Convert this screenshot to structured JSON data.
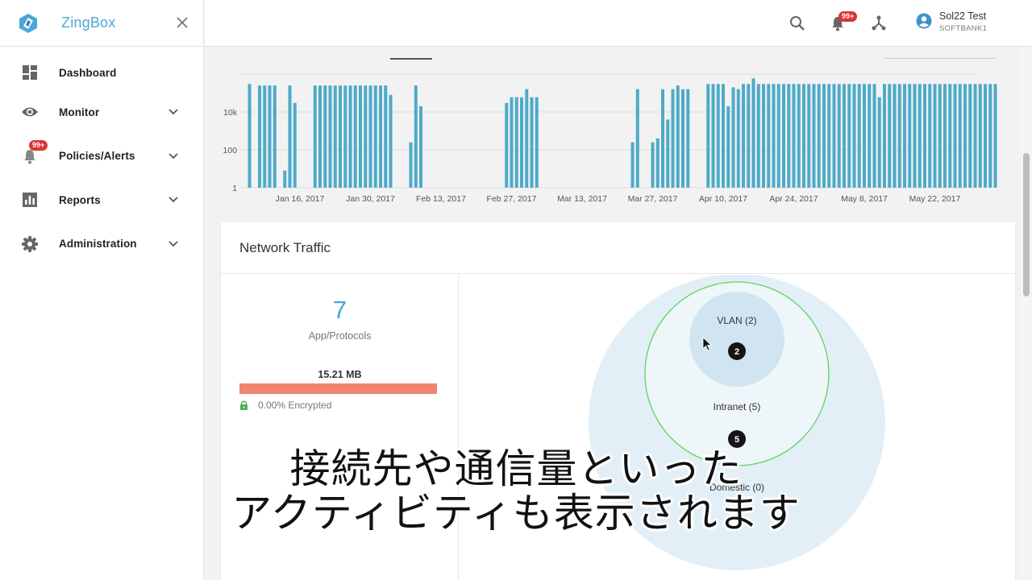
{
  "app": {
    "name": "ZingBox"
  },
  "sidebar": {
    "items": [
      {
        "label": "Dashboard",
        "icon": "dashboard-icon"
      },
      {
        "label": "Monitor",
        "icon": "eye-icon"
      },
      {
        "label": "Policies/Alerts",
        "icon": "bell-icon",
        "badge": "99+"
      },
      {
        "label": "Reports",
        "icon": "bar-chart-icon"
      },
      {
        "label": "Administration",
        "icon": "gear-icon"
      }
    ]
  },
  "topbar": {
    "notifications_badge": "99+",
    "user_name": "Sol22 Test",
    "user_org": "SOFTBANK1"
  },
  "chart_data": {
    "type": "bar",
    "y_scale": "log",
    "y_ticks": [
      "10k",
      "100",
      "1"
    ],
    "x_ticks": [
      "Jan 16, 2017",
      "Jan 30, 2017",
      "Feb 13, 2017",
      "Feb 27, 2017",
      "Mar 13, 2017",
      "Mar 27, 2017",
      "Apr 10, 2017",
      "Apr 24, 2017",
      "May 8, 2017",
      "May 22, 2017"
    ],
    "bar_color": "#4eaac8",
    "series": [
      {
        "x": [
          "2017-01-06",
          "2017-01-08",
          "2017-01-09",
          "2017-01-10",
          "2017-01-11",
          "2017-01-13",
          "2017-01-14",
          "2017-01-15",
          "2017-01-19",
          "2017-01-20",
          "2017-01-21",
          "2017-01-22",
          "2017-01-23",
          "2017-01-24",
          "2017-01-25",
          "2017-01-26",
          "2017-01-27",
          "2017-01-28",
          "2017-01-29",
          "2017-01-30",
          "2017-01-31",
          "2017-02-01",
          "2017-02-02",
          "2017-02-03",
          "2017-02-07",
          "2017-02-08",
          "2017-02-09",
          "2017-02-26",
          "2017-02-27",
          "2017-02-28",
          "2017-03-01",
          "2017-03-02",
          "2017-03-03",
          "2017-03-04",
          "2017-03-23",
          "2017-03-24",
          "2017-03-27",
          "2017-03-28",
          "2017-03-29",
          "2017-03-30",
          "2017-03-31",
          "2017-04-01",
          "2017-04-02",
          "2017-04-03",
          "2017-04-07",
          "2017-04-08",
          "2017-04-09",
          "2017-04-10",
          "2017-04-11",
          "2017-04-12",
          "2017-04-13",
          "2017-04-14",
          "2017-04-15",
          "2017-04-16",
          "2017-04-17",
          "2017-04-18",
          "2017-04-19",
          "2017-04-20",
          "2017-04-21",
          "2017-04-22",
          "2017-04-23",
          "2017-04-24",
          "2017-04-25",
          "2017-04-26",
          "2017-04-27",
          "2017-04-28",
          "2017-04-29",
          "2017-04-30",
          "2017-05-01",
          "2017-05-02",
          "2017-05-03",
          "2017-05-04",
          "2017-05-05",
          "2017-05-06",
          "2017-05-07",
          "2017-05-08",
          "2017-05-09",
          "2017-05-10",
          "2017-05-11",
          "2017-05-12",
          "2017-05-13",
          "2017-05-14",
          "2017-05-15",
          "2017-05-16",
          "2017-05-17",
          "2017-05-18",
          "2017-05-19",
          "2017-05-20",
          "2017-05-21",
          "2017-05-22",
          "2017-05-23",
          "2017-05-24",
          "2017-05-25",
          "2017-05-26",
          "2017-05-27",
          "2017-05-28",
          "2017-05-29",
          "2017-05-30",
          "2017-05-31",
          "2017-06-01",
          "2017-06-02",
          "2017-06-03"
        ],
        "values": [
          300000,
          250000,
          250000,
          250000,
          250000,
          8,
          250000,
          30000,
          250000,
          250000,
          250000,
          250000,
          250000,
          250000,
          250000,
          250000,
          250000,
          250000,
          250000,
          250000,
          250000,
          250000,
          250000,
          80000,
          250,
          250000,
          20000,
          30000,
          60000,
          60000,
          60000,
          160000,
          60000,
          60000,
          250,
          160000,
          250,
          400,
          160000,
          4000,
          160000,
          250000,
          160000,
          160000,
          300000,
          300000,
          300000,
          300000,
          20000,
          200000,
          160000,
          300000,
          300000,
          600000,
          300000,
          300000,
          300000,
          300000,
          300000,
          300000,
          300000,
          300000,
          300000,
          300000,
          300000,
          300000,
          300000,
          300000,
          300000,
          300000,
          300000,
          300000,
          300000,
          300000,
          300000,
          300000,
          300000,
          300000,
          60000,
          300000,
          300000,
          300000,
          300000,
          300000,
          300000,
          300000,
          300000,
          300000,
          300000,
          300000,
          300000,
          300000,
          300000,
          300000,
          300000,
          300000,
          300000,
          300000,
          300000,
          300000,
          300000,
          300000
        ]
      }
    ]
  },
  "network_traffic": {
    "title": "Network Traffic",
    "app_count": "7",
    "app_label": "App/Protocols",
    "total_size": "15.21 MB",
    "encrypted_label": "0.00% Encrypted",
    "encrypted_fraction": 0.0
  },
  "bubbles": {
    "vlan_label": "VLAN (2)",
    "vlan_count": "2",
    "intranet_label": "Intranet (5)",
    "intranet_count": "5",
    "domestic_label": "Domestic (0)"
  },
  "subtitles": {
    "line1": "接続先や通信量といった",
    "line2": "アクティビティも表示されます"
  }
}
